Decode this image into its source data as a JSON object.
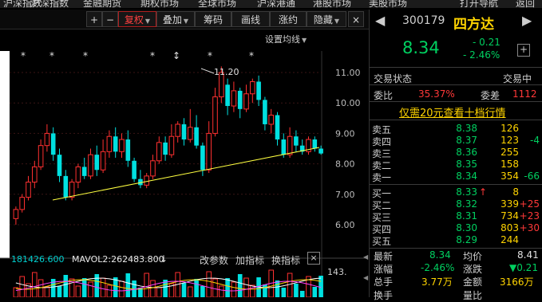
{
  "topnav": [
    "沪深指数",
    "金融期货",
    "期权市场",
    "全球市场",
    "沪深港通",
    "港股市场",
    "美股市场",
    "打开导航",
    "返回"
  ],
  "toolbar": {
    "plus": "+",
    "minus": "−",
    "fuquan": "复权",
    "diejia": "叠加",
    "choumaa": "筹码",
    "huaxian": "画线",
    "tiaoyue": "涨约",
    "yincang": "隐藏",
    "close": "×"
  },
  "chart": {
    "settings_label": "设置均线",
    "peak_label": "11.20",
    "y_ticks": [
      "11.00",
      "10.00",
      "9.00",
      "8.00",
      "7.00",
      "6.00"
    ],
    "vol_tick": "143.",
    "vol_bar_text": "181426.600",
    "mavol2": "MAVOL2:262483.800",
    "vol_buttons": [
      "改参数",
      "加指标",
      "换指标"
    ],
    "star_positions_note": ""
  },
  "quote": {
    "code": "300179",
    "name": "四方达",
    "price": "8.34",
    "change": "- 0.21",
    "change_pct": "- 2.46%",
    "status_label": "交易状态",
    "status_value": "交易中",
    "weibi_label": "委比",
    "weibi_value": "35.37%",
    "weicha_label": "委差",
    "weicha_value": "1112",
    "level10_link": "仅需20元查看十档行情",
    "sell": [
      {
        "name": "卖五",
        "price": "8.38",
        "vol": "126",
        "delta": ""
      },
      {
        "name": "卖四",
        "price": "8.37",
        "vol": "123",
        "delta": "-4"
      },
      {
        "name": "卖三",
        "price": "8.36",
        "vol": "255",
        "delta": ""
      },
      {
        "name": "卖二",
        "price": "8.35",
        "vol": "158",
        "delta": ""
      },
      {
        "name": "卖一",
        "price": "8.34",
        "vol": "354",
        "delta": "-66"
      }
    ],
    "buy": [
      {
        "name": "买一",
        "price": "8.33",
        "vol": "8",
        "delta": "",
        "arrow": "↑"
      },
      {
        "name": "买二",
        "price": "8.32",
        "vol": "339",
        "delta": "+25",
        "arrow": ""
      },
      {
        "name": "买三",
        "price": "8.31",
        "vol": "734",
        "delta": "+23",
        "arrow": ""
      },
      {
        "name": "买四",
        "price": "8.30",
        "vol": "803",
        "delta": "+30",
        "arrow": ""
      },
      {
        "name": "买五",
        "price": "8.29",
        "vol": "244",
        "delta": "",
        "arrow": ""
      }
    ],
    "stats": {
      "latest_label": "最新",
      "latest": "8.34",
      "avg_label": "均价",
      "avg": "8.41",
      "pct_label": "涨幅",
      "pct": "-2.46%",
      "chg_label": "涨跌",
      "chg": "▼0.21",
      "hands_label": "总手",
      "hands": "3.77万",
      "amt_label": "金额",
      "amt": "3166万",
      "bottom1": "换手",
      "bottom2": "量比"
    }
  },
  "candles": [
    {
      "o": 6.2,
      "c": 6.5,
      "h": 6.6,
      "l": 6.0
    },
    {
      "o": 6.5,
      "c": 6.9,
      "h": 7.0,
      "l": 6.4
    },
    {
      "o": 6.9,
      "c": 7.4,
      "h": 7.6,
      "l": 6.8
    },
    {
      "o": 7.4,
      "c": 7.9,
      "h": 8.1,
      "l": 7.2
    },
    {
      "o": 7.9,
      "c": 8.6,
      "h": 8.8,
      "l": 7.8
    },
    {
      "o": 8.6,
      "c": 9.0,
      "h": 9.3,
      "l": 8.4
    },
    {
      "o": 9.0,
      "c": 8.3,
      "h": 9.2,
      "l": 8.1
    },
    {
      "o": 8.3,
      "c": 7.6,
      "h": 8.5,
      "l": 7.4
    },
    {
      "o": 7.6,
      "c": 6.9,
      "h": 7.8,
      "l": 6.8
    },
    {
      "o": 6.9,
      "c": 7.4,
      "h": 7.5,
      "l": 6.8
    },
    {
      "o": 7.4,
      "c": 7.9,
      "h": 8.0,
      "l": 7.2
    },
    {
      "o": 7.9,
      "c": 7.6,
      "h": 8.2,
      "l": 7.5
    },
    {
      "o": 7.6,
      "c": 8.3,
      "h": 8.5,
      "l": 7.5
    },
    {
      "o": 8.3,
      "c": 7.8,
      "h": 8.6,
      "l": 7.6
    },
    {
      "o": 7.8,
      "c": 8.4,
      "h": 8.8,
      "l": 7.7
    },
    {
      "o": 8.4,
      "c": 8.9,
      "h": 9.1,
      "l": 8.2
    },
    {
      "o": 8.9,
      "c": 8.4,
      "h": 9.2,
      "l": 8.2
    },
    {
      "o": 8.4,
      "c": 8.8,
      "h": 9.0,
      "l": 8.2
    },
    {
      "o": 8.8,
      "c": 8.1,
      "h": 9.1,
      "l": 7.9
    },
    {
      "o": 8.1,
      "c": 7.5,
      "h": 8.2,
      "l": 7.4
    },
    {
      "o": 7.5,
      "c": 7.3,
      "h": 7.8,
      "l": 7.2
    },
    {
      "o": 7.3,
      "c": 7.6,
      "h": 7.7,
      "l": 7.2
    },
    {
      "o": 7.6,
      "c": 8.1,
      "h": 8.3,
      "l": 7.5
    },
    {
      "o": 8.1,
      "c": 8.7,
      "h": 8.9,
      "l": 8.0
    },
    {
      "o": 8.7,
      "c": 8.3,
      "h": 8.9,
      "l": 8.1
    },
    {
      "o": 8.3,
      "c": 8.9,
      "h": 9.3,
      "l": 8.2
    },
    {
      "o": 8.9,
      "c": 9.3,
      "h": 9.4,
      "l": 8.7
    },
    {
      "o": 9.3,
      "c": 8.8,
      "h": 9.5,
      "l": 8.6
    },
    {
      "o": 8.8,
      "c": 9.2,
      "h": 9.8,
      "l": 8.7
    },
    {
      "o": 9.2,
      "c": 8.6,
      "h": 9.6,
      "l": 8.5
    },
    {
      "o": 8.6,
      "c": 7.8,
      "h": 8.7,
      "l": 7.6
    },
    {
      "o": 7.8,
      "c": 9.0,
      "h": 9.4,
      "l": 7.7
    },
    {
      "o": 9.0,
      "c": 10.2,
      "h": 10.5,
      "l": 8.9
    },
    {
      "o": 10.2,
      "c": 11.0,
      "h": 11.2,
      "l": 10.0
    },
    {
      "o": 10.6,
      "c": 9.9,
      "h": 10.8,
      "l": 9.6
    },
    {
      "o": 9.9,
      "c": 10.4,
      "h": 10.7,
      "l": 9.7
    },
    {
      "o": 10.4,
      "c": 9.8,
      "h": 10.5,
      "l": 9.5
    },
    {
      "o": 9.8,
      "c": 10.3,
      "h": 10.6,
      "l": 9.7
    },
    {
      "o": 10.3,
      "c": 10.7,
      "h": 10.8,
      "l": 10.0
    },
    {
      "o": 10.7,
      "c": 10.1,
      "h": 10.9,
      "l": 9.9
    },
    {
      "o": 10.1,
      "c": 9.3,
      "h": 10.2,
      "l": 9.1
    },
    {
      "o": 9.3,
      "c": 9.6,
      "h": 9.8,
      "l": 9.0
    },
    {
      "o": 9.6,
      "c": 8.8,
      "h": 9.7,
      "l": 8.6
    },
    {
      "o": 8.8,
      "c": 8.3,
      "h": 9.0,
      "l": 8.2
    },
    {
      "o": 8.3,
      "c": 8.9,
      "h": 9.2,
      "l": 8.2
    },
    {
      "o": 8.9,
      "c": 8.6,
      "h": 9.1,
      "l": 8.4
    },
    {
      "o": 8.6,
      "c": 8.4,
      "h": 8.8,
      "l": 8.3
    },
    {
      "o": 8.4,
      "c": 8.8,
      "h": 8.9,
      "l": 8.3
    },
    {
      "o": 8.8,
      "c": 8.5,
      "h": 8.9,
      "l": 8.4
    },
    {
      "o": 8.5,
      "c": 8.34,
      "h": 8.6,
      "l": 8.3
    }
  ]
}
